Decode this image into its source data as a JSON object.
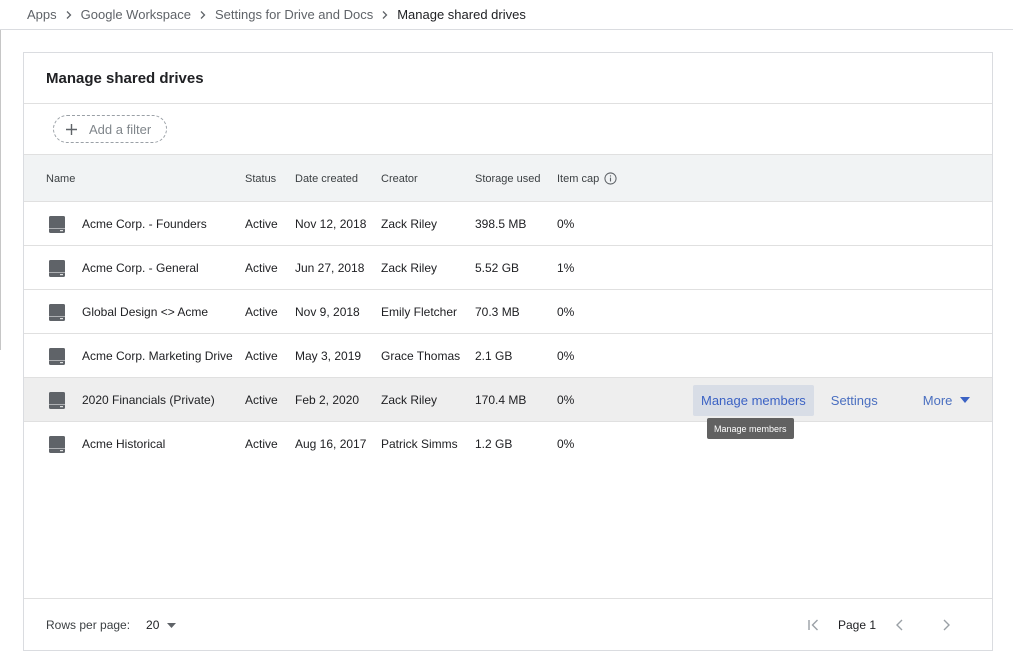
{
  "breadcrumb": [
    "Apps",
    "Google Workspace",
    "Settings for Drive and Docs",
    "Manage shared drives"
  ],
  "card": {
    "title": "Manage shared drives"
  },
  "filter": {
    "label": "Add a filter"
  },
  "columns": {
    "name": "Name",
    "status": "Status",
    "date": "Date created",
    "creator": "Creator",
    "storage": "Storage used",
    "cap": "Item cap"
  },
  "rows": [
    {
      "name": "Acme Corp. - Founders",
      "status": "Active",
      "date": "Nov 12, 2018",
      "creator": "Zack Riley",
      "storage": "398.5 MB",
      "cap": "0%"
    },
    {
      "name": "Acme Corp. - General",
      "status": "Active",
      "date": "Jun 27, 2018",
      "creator": "Zack Riley",
      "storage": "5.52 GB",
      "cap": "1%"
    },
    {
      "name": "Global Design <> Acme",
      "status": "Active",
      "date": "Nov 9, 2018",
      "creator": "Emily Fletcher",
      "storage": "70.3 MB",
      "cap": "0%"
    },
    {
      "name": "Acme Corp. Marketing Drive",
      "status": "Active",
      "date": "May 3, 2019",
      "creator": "Grace Thomas",
      "storage": "2.1 GB",
      "cap": "0%"
    },
    {
      "name": "2020 Financials (Private)",
      "status": "Active",
      "date": "Feb 2, 2020",
      "creator": "Zack Riley",
      "storage": "170.4 MB",
      "cap": "0%"
    },
    {
      "name": "Acme Historical",
      "status": "Active",
      "date": "Aug 16, 2017",
      "creator": "Patrick Simms",
      "storage": "1.2 GB",
      "cap": "0%"
    }
  ],
  "row_actions": {
    "manage": "Manage members",
    "settings": "Settings",
    "more": "More"
  },
  "tooltip": "Manage members",
  "footer": {
    "rows_per_page_label": "Rows per page:",
    "rows_per_page_value": "20",
    "page_label": "Page 1"
  },
  "colors": {
    "accent": "#3b62c4",
    "hover_row": "#eeeeee",
    "header_bg": "#f1f3f4",
    "icon_gray": "#5f6368"
  },
  "icons": {
    "breadcrumb_separator": "chevron-right-icon",
    "filter": "plus-icon",
    "info": "info-icon",
    "drive": "shared-drive-icon",
    "more": "caret-down-icon",
    "first_page": "first-page-icon",
    "prev_page": "chevron-left-icon",
    "next_page": "chevron-right-icon"
  }
}
